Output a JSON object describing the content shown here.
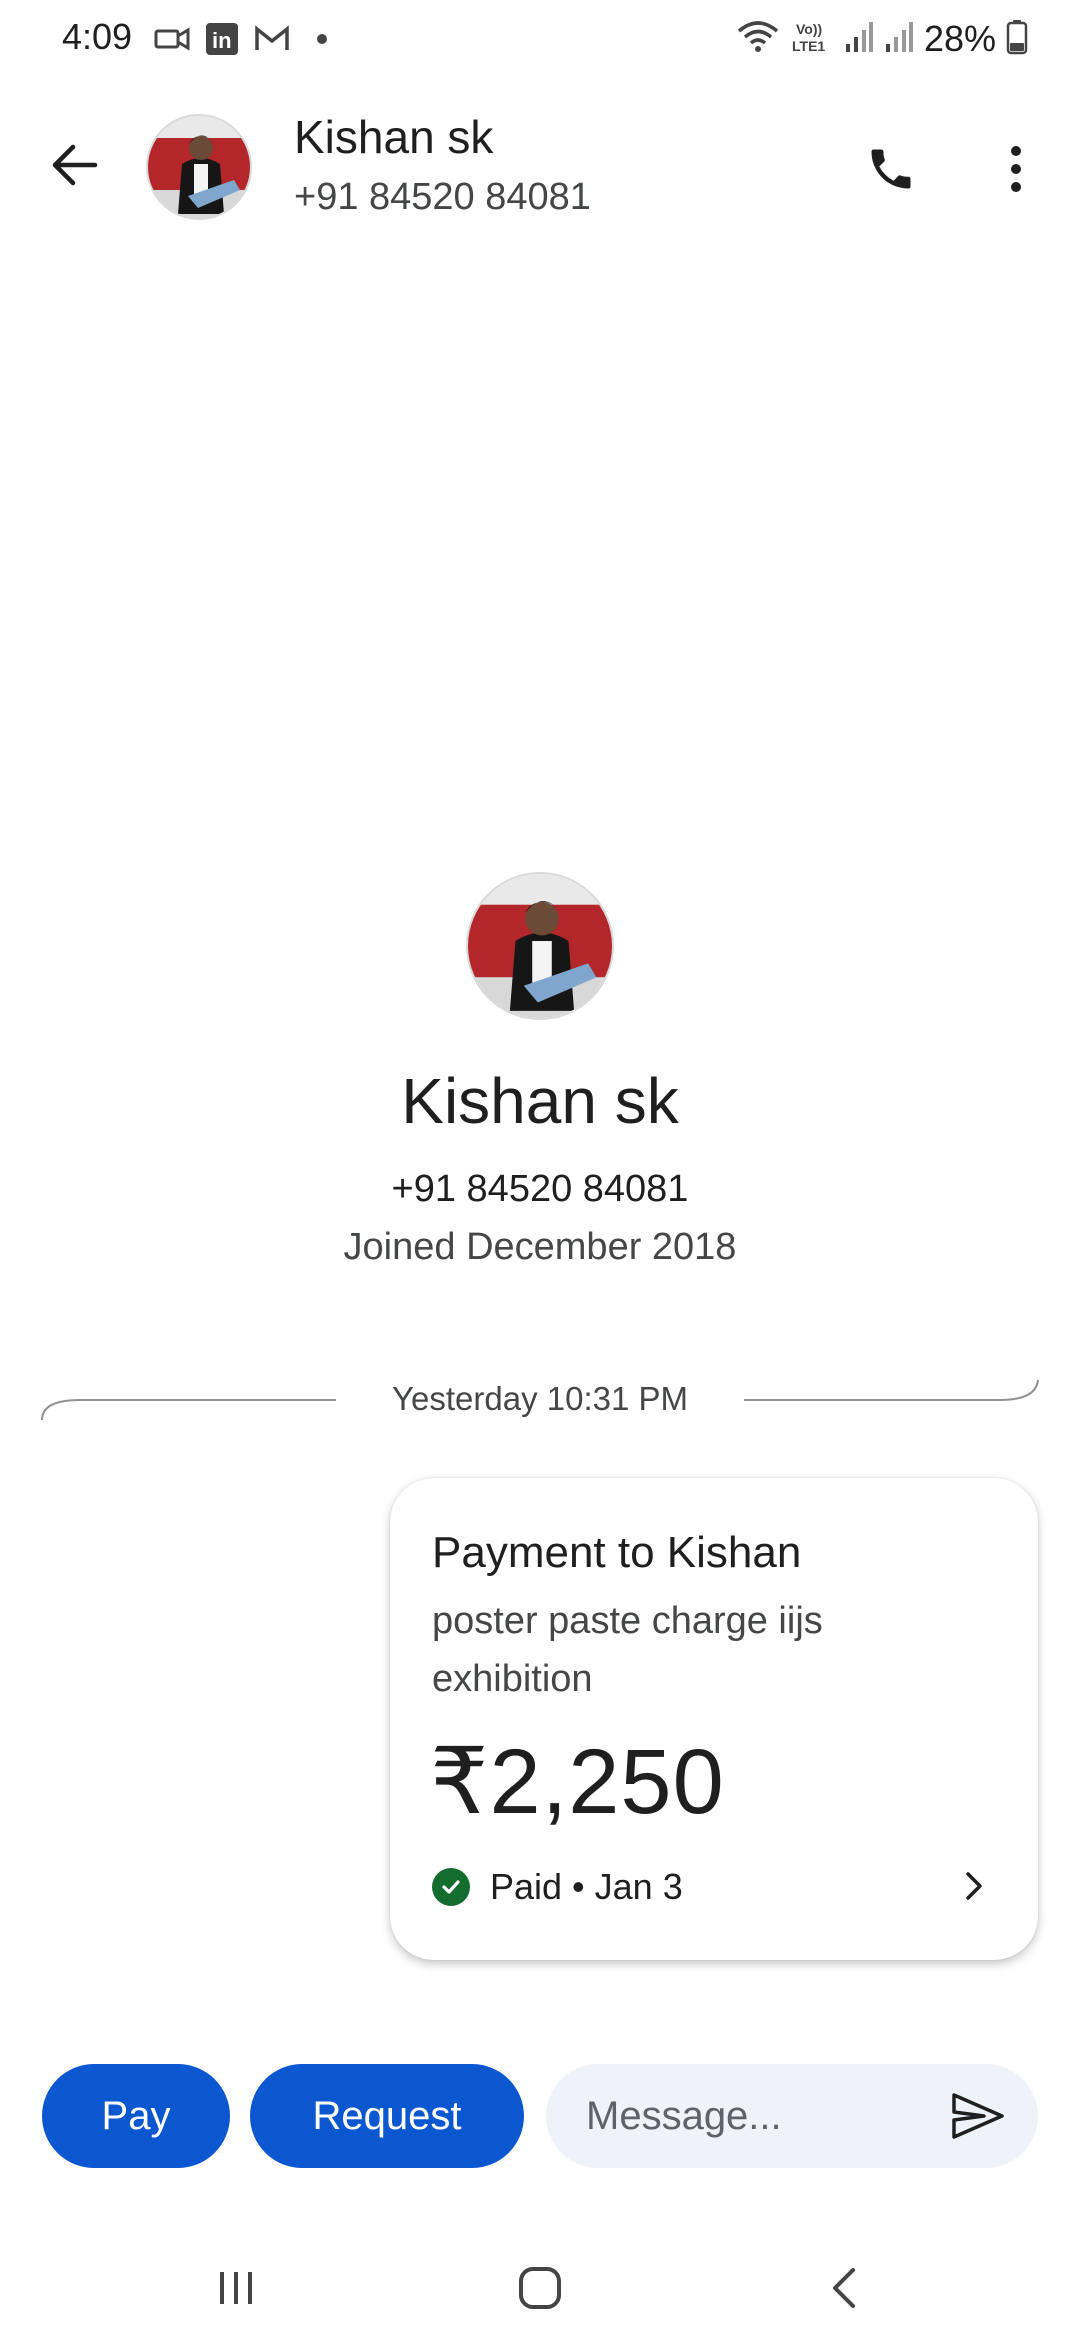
{
  "status_bar": {
    "time": "4:09",
    "battery": "28%",
    "notification_icons": [
      "camera-icon",
      "linkedin-icon",
      "gmail-icon",
      "dot-icon"
    ],
    "system_icons": [
      "wifi-icon",
      "volte-icon",
      "signal-icon",
      "signal-icon",
      "battery-icon"
    ],
    "volte_label_top": "Vo))",
    "volte_label_bottom": "LTE1",
    "linkedin_label": "in"
  },
  "header": {
    "contact_name": "Kishan sk",
    "contact_phone": "+91 84520 84081"
  },
  "profile": {
    "name": "Kishan sk",
    "phone": "+91 84520 84081",
    "joined": "Joined December 2018"
  },
  "conversation": {
    "timestamp": "Yesterday 10:31 PM",
    "payment": {
      "title": "Payment to Kishan",
      "note": "poster paste charge iijs exhibition",
      "amount": "₹2,250",
      "status": "Paid • Jan 3",
      "status_color": "#146c2e"
    }
  },
  "actions": {
    "pay_label": "Pay",
    "request_label": "Request",
    "message_placeholder": "Message...",
    "accent_color": "#0b57d0"
  }
}
